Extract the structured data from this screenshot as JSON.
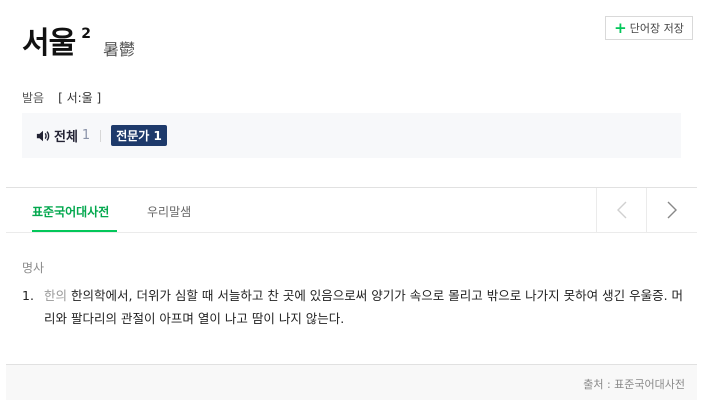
{
  "entry": {
    "headword": "서울",
    "homonym_number": "2",
    "hanja": "暑鬱"
  },
  "save_button": {
    "label": "단어장 저장"
  },
  "pronunciation": {
    "label": "발음",
    "value": "[ 서:울 ]"
  },
  "audio": {
    "all_label": "전체",
    "all_count": "1",
    "expert_label": "전문가 1"
  },
  "tabs": [
    {
      "label": "표준국어대사전",
      "active": true
    },
    {
      "label": "우리말샘",
      "active": false
    }
  ],
  "definition": {
    "part_of_speech": "명사",
    "number": "1.",
    "field_tag": "한의",
    "text": "한의학에서, 더위가 심할 때 서늘하고 찬 곳에 있음으로써 양기가 속으로 몰리고 밖으로 나가지 못하여 생긴 우울증. 머리와 팔다리의 관절이 아프며 열이 나고 땀이 나지 않는다."
  },
  "footer": {
    "source": "출처 : 표준국어대사전"
  },
  "colors": {
    "accent": "#03c75a",
    "expert_badge": "#1e3a6b"
  }
}
